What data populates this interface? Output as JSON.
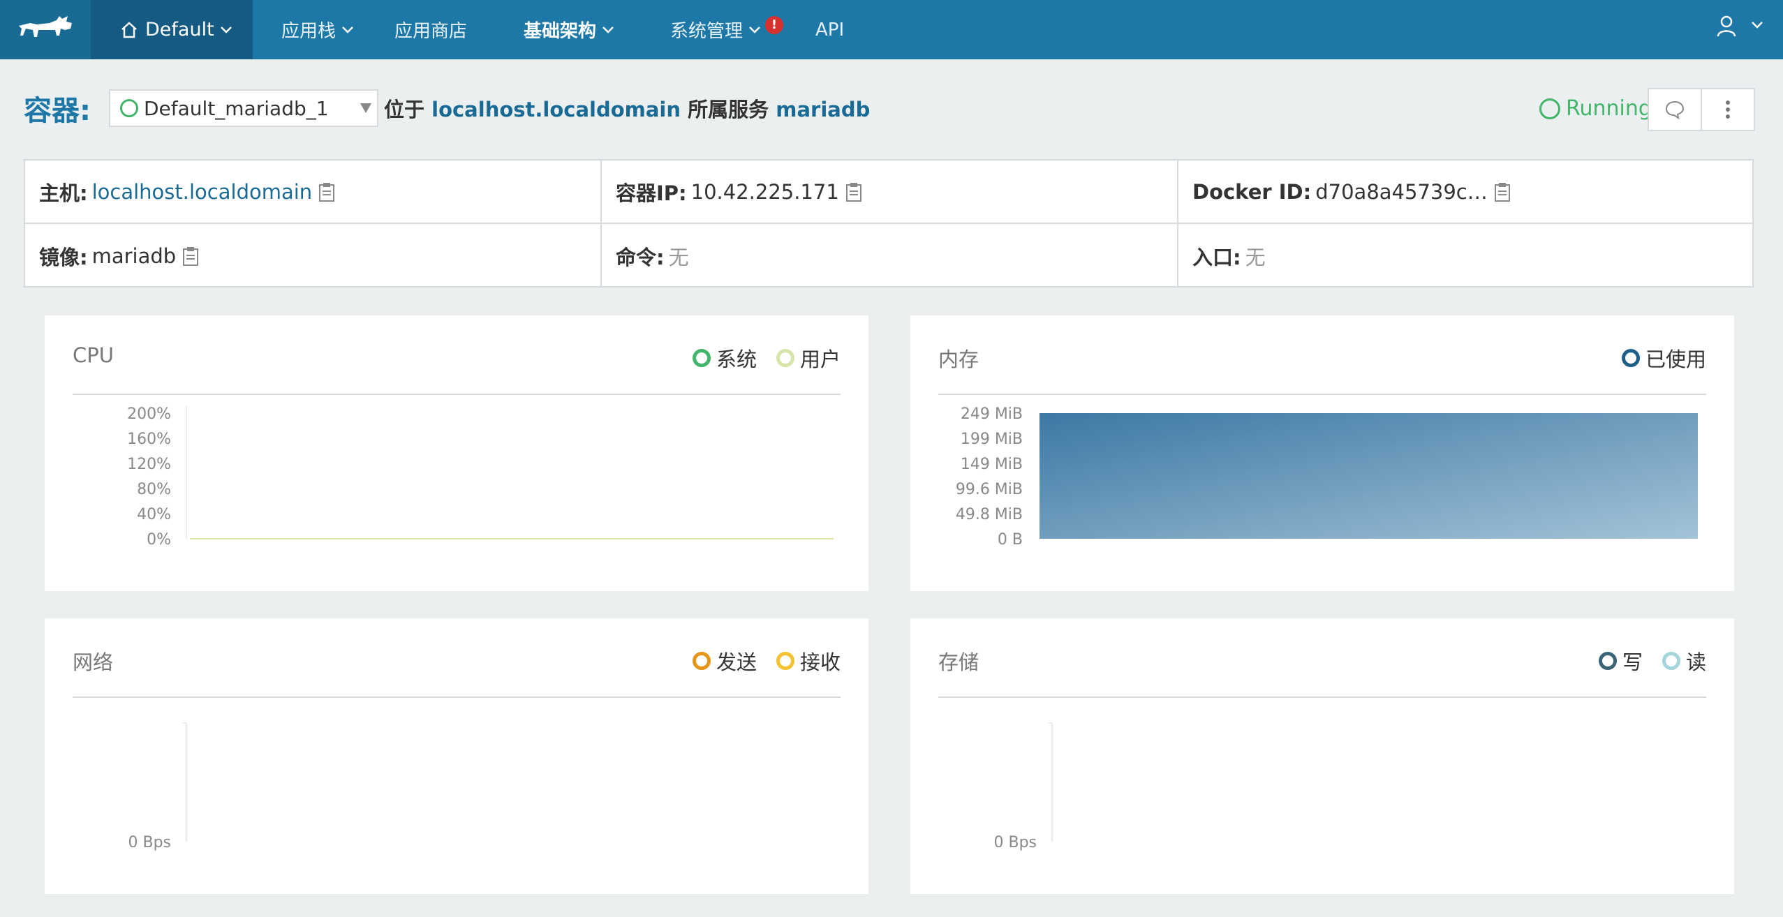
{
  "nav": {
    "env_label": "Default",
    "items": [
      {
        "label": "应用栈",
        "has_dropdown": true,
        "bold": false
      },
      {
        "label": "应用商店",
        "has_dropdown": false,
        "bold": false
      },
      {
        "label": "基础架构",
        "has_dropdown": true,
        "bold": true
      },
      {
        "label": "系统管理",
        "has_dropdown": true,
        "bold": false,
        "alert": "!"
      },
      {
        "label": "API",
        "has_dropdown": false,
        "bold": false
      }
    ]
  },
  "header": {
    "title": "容器:",
    "container_name": "Default_mariadb_1",
    "located_on": "位于",
    "host": "localhost.localdomain",
    "belongs_service": "所属服务",
    "service": "mariadb",
    "state": "Running"
  },
  "info": {
    "host_label": "主机:",
    "host_value": "localhost.localdomain",
    "ip_label": "容器IP:",
    "ip_value": "10.42.225.171",
    "docker_label": "Docker ID:",
    "docker_value": "d70a8a45739c…",
    "image_label": "镜像:",
    "image_value": "mariadb",
    "cmd_label": "命令:",
    "cmd_value": "无",
    "entry_label": "入口:",
    "entry_value": "无"
  },
  "colors": {
    "nav_bg": "#1d78a8",
    "accent": "#1a6a96",
    "running": "#41b56a",
    "cpu_system": "#41b56a",
    "cpu_user": "#d5e4a8",
    "mem_used": "#1d5f87",
    "net_tx": "#e5951a",
    "net_rx": "#f2c230",
    "disk_write": "#3b6577",
    "disk_read": "#a6d4db"
  },
  "cpu": {
    "title": "CPU",
    "legend": [
      "系统",
      "用户"
    ],
    "chart_data": {
      "type": "area",
      "ylim": [
        0,
        200
      ],
      "yticks": [
        "200%",
        "160%",
        "120%",
        "80%",
        "40%",
        "0%"
      ],
      "series": [
        {
          "name": "系统",
          "values": [
            0,
            0,
            0,
            0,
            0,
            0,
            0,
            0,
            0,
            0
          ]
        },
        {
          "name": "用户",
          "values": [
            0,
            0,
            0,
            0,
            0,
            0,
            0,
            0,
            0,
            0
          ]
        }
      ]
    }
  },
  "memory": {
    "title": "内存",
    "legend": [
      "已使用"
    ],
    "chart_data": {
      "type": "area",
      "yticks": [
        "249 MiB",
        "199 MiB",
        "149 MiB",
        "99.6 MiB",
        "49.8 MiB",
        "0 B"
      ],
      "ylim": [
        0,
        249
      ],
      "series": [
        {
          "name": "已使用",
          "values": [
            249,
            249
          ]
        }
      ]
    }
  },
  "network": {
    "title": "网络",
    "legend": [
      "发送",
      "接收"
    ],
    "chart_data": {
      "type": "line",
      "yticks": [
        "0 Bps"
      ],
      "series": [
        {
          "name": "发送",
          "values": []
        },
        {
          "name": "接收",
          "values": []
        }
      ]
    }
  },
  "storage": {
    "title": "存储",
    "legend": [
      "写",
      "读"
    ],
    "chart_data": {
      "type": "line",
      "yticks": [
        "0 Bps"
      ],
      "series": [
        {
          "name": "写",
          "values": []
        },
        {
          "name": "读",
          "values": []
        }
      ]
    }
  }
}
